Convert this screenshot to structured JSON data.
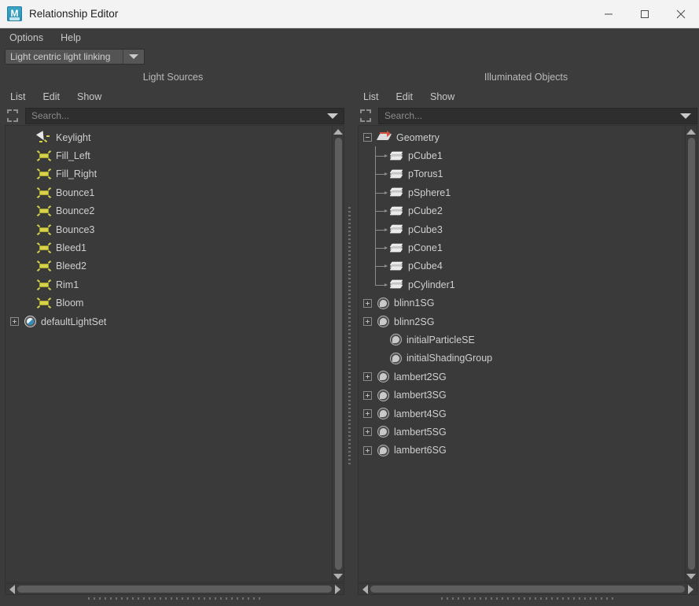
{
  "window": {
    "title": "Relationship Editor",
    "app_icon": "maya-logo-icon",
    "controls": {
      "minimize": "minimize-icon",
      "maximize": "maximize-icon",
      "close": "close-icon"
    }
  },
  "menubar": {
    "items": [
      {
        "label": "Options"
      },
      {
        "label": "Help"
      }
    ]
  },
  "mode": {
    "value": "Light centric light linking",
    "dropdown_icon": "chevron-down-icon"
  },
  "panels": [
    {
      "id": "light-sources",
      "title": "Light Sources",
      "menu": [
        {
          "label": "List"
        },
        {
          "label": "Edit"
        },
        {
          "label": "Show"
        }
      ],
      "search": {
        "placeholder": "Search...",
        "value": "",
        "select_icon": "selection-brackets-icon",
        "dropdown_icon": "chevron-down-icon"
      },
      "rows": [
        {
          "label": "Keylight",
          "icon": "spot-light-icon",
          "indent": 0,
          "expander": "none",
          "connector": false
        },
        {
          "label": "Fill_Left",
          "icon": "area-light-icon",
          "indent": 0,
          "expander": "none",
          "connector": false
        },
        {
          "label": "Fill_Right",
          "icon": "area-light-icon",
          "indent": 0,
          "expander": "none",
          "connector": false
        },
        {
          "label": "Bounce1",
          "icon": "area-light-icon",
          "indent": 0,
          "expander": "none",
          "connector": false
        },
        {
          "label": "Bounce2",
          "icon": "area-light-icon",
          "indent": 0,
          "expander": "none",
          "connector": false
        },
        {
          "label": "Bounce3",
          "icon": "area-light-icon",
          "indent": 0,
          "expander": "none",
          "connector": false
        },
        {
          "label": "Bleed1",
          "icon": "area-light-icon",
          "indent": 0,
          "expander": "none",
          "connector": false
        },
        {
          "label": "Bleed2",
          "icon": "area-light-icon",
          "indent": 0,
          "expander": "none",
          "connector": false
        },
        {
          "label": "Rim1",
          "icon": "area-light-icon",
          "indent": 0,
          "expander": "none",
          "connector": false
        },
        {
          "label": "Bloom",
          "icon": "area-light-icon",
          "indent": 0,
          "expander": "none",
          "connector": false
        },
        {
          "label": "defaultLightSet",
          "icon": "light-set-icon",
          "indent": -1,
          "expander": "plus",
          "connector": false
        }
      ],
      "vscroll": {
        "up_icon": "scroll-up-arrow-icon",
        "down_icon": "scroll-down-arrow-icon",
        "thumb_pct": 100
      },
      "hscroll": {
        "left_icon": "scroll-left-arrow-icon",
        "right_icon": "scroll-right-arrow-icon",
        "thumb_pct": 100
      }
    },
    {
      "id": "illuminated-objects",
      "title": "Illuminated Objects",
      "menu": [
        {
          "label": "List"
        },
        {
          "label": "Edit"
        },
        {
          "label": "Show"
        }
      ],
      "search": {
        "placeholder": "Search...",
        "value": "",
        "select_icon": "selection-brackets-icon",
        "dropdown_icon": "chevron-down-icon"
      },
      "rows": [
        {
          "label": "Geometry",
          "icon": "transform-node-icon",
          "indent": -1,
          "expander": "minus",
          "connector": false
        },
        {
          "label": "pCube1",
          "icon": "mesh-icon",
          "indent": 1,
          "expander": "none",
          "connector": true
        },
        {
          "label": "pTorus1",
          "icon": "mesh-icon",
          "indent": 1,
          "expander": "none",
          "connector": true
        },
        {
          "label": "pSphere1",
          "icon": "mesh-icon",
          "indent": 1,
          "expander": "none",
          "connector": true
        },
        {
          "label": "pCube2",
          "icon": "mesh-icon",
          "indent": 1,
          "expander": "none",
          "connector": true
        },
        {
          "label": "pCube3",
          "icon": "mesh-icon",
          "indent": 1,
          "expander": "none",
          "connector": true
        },
        {
          "label": "pCone1",
          "icon": "mesh-icon",
          "indent": 1,
          "expander": "none",
          "connector": true
        },
        {
          "label": "pCube4",
          "icon": "mesh-icon",
          "indent": 1,
          "expander": "none",
          "connector": true
        },
        {
          "label": "pCylinder1",
          "icon": "mesh-icon",
          "indent": 1,
          "expander": "none",
          "connector": "last"
        },
        {
          "label": "blinn1SG",
          "icon": "shading-group-icon",
          "indent": -1,
          "expander": "plus",
          "connector": false
        },
        {
          "label": "blinn2SG",
          "icon": "shading-group-icon",
          "indent": -1,
          "expander": "plus",
          "connector": false
        },
        {
          "label": "initialParticleSE",
          "icon": "shading-group-icon",
          "indent": 0,
          "expander": "none",
          "connector": false
        },
        {
          "label": "initialShadingGroup",
          "icon": "shading-group-icon",
          "indent": 0,
          "expander": "none",
          "connector": false
        },
        {
          "label": "lambert2SG",
          "icon": "shading-group-icon",
          "indent": -1,
          "expander": "plus",
          "connector": false
        },
        {
          "label": "lambert3SG",
          "icon": "shading-group-icon",
          "indent": -1,
          "expander": "plus",
          "connector": false
        },
        {
          "label": "lambert4SG",
          "icon": "shading-group-icon",
          "indent": -1,
          "expander": "plus",
          "connector": false
        },
        {
          "label": "lambert5SG",
          "icon": "shading-group-icon",
          "indent": -1,
          "expander": "plus",
          "connector": false
        },
        {
          "label": "lambert6SG",
          "icon": "shading-group-icon",
          "indent": -1,
          "expander": "plus",
          "connector": false
        }
      ],
      "vscroll": {
        "up_icon": "scroll-up-arrow-icon",
        "down_icon": "scroll-down-arrow-icon",
        "thumb_pct": 100
      },
      "hscroll": {
        "left_icon": "scroll-left-arrow-icon",
        "right_icon": "scroll-right-arrow-icon",
        "thumb_pct": 100
      }
    }
  ],
  "colors": {
    "window_chrome": "#3c3c3c",
    "list_background": "#3a3a3a",
    "titlebar": "#f3f3f3",
    "text": "#cfcfcf",
    "light_icon_yellow": "#d6d24a",
    "transform_accent_red": "#d14f3c",
    "maya_teal": "#2a90b4"
  }
}
